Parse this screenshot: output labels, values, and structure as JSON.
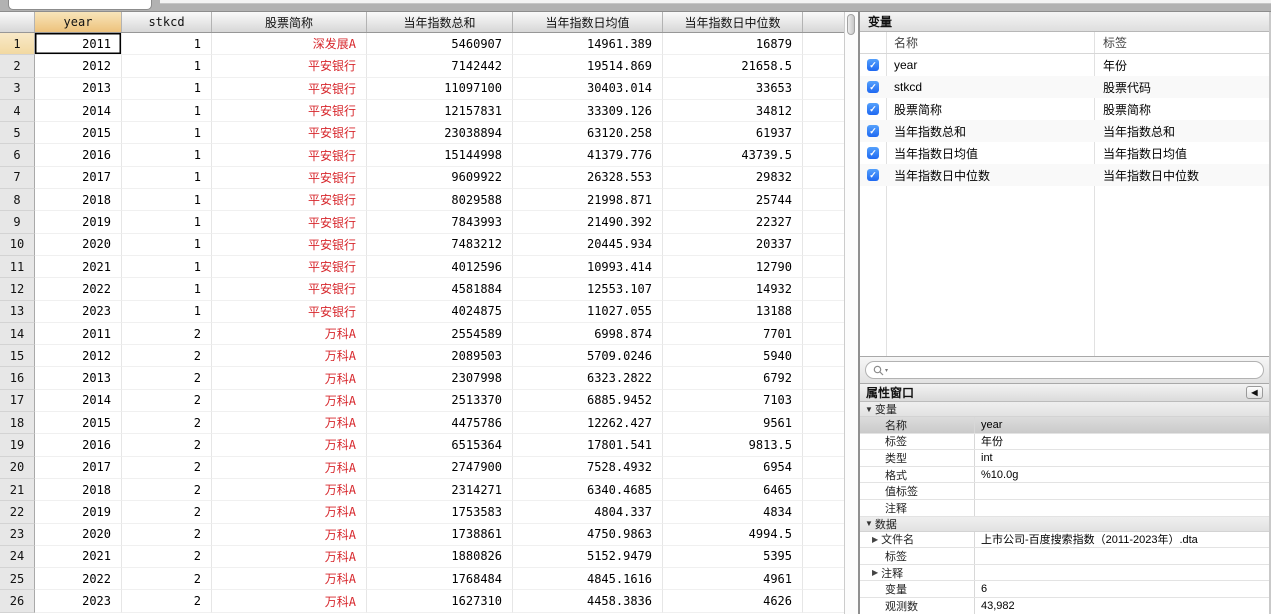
{
  "table": {
    "headers": {
      "year": "year",
      "stkcd": "stkcd",
      "name": "股票简称",
      "sum": "当年指数总和",
      "mean": "当年指数日均值",
      "median": "当年指数日中位数"
    },
    "selected_cell": {
      "row": 1,
      "column": "year",
      "value": "2011"
    },
    "rows": [
      {
        "n": "1",
        "year": "2011",
        "stkcd": "1",
        "name": "深发展A",
        "sum": "5460907",
        "mean": "14961.389",
        "median": "16879"
      },
      {
        "n": "2",
        "year": "2012",
        "stkcd": "1",
        "name": "平安银行",
        "sum": "7142442",
        "mean": "19514.869",
        "median": "21658.5"
      },
      {
        "n": "3",
        "year": "2013",
        "stkcd": "1",
        "name": "平安银行",
        "sum": "11097100",
        "mean": "30403.014",
        "median": "33653"
      },
      {
        "n": "4",
        "year": "2014",
        "stkcd": "1",
        "name": "平安银行",
        "sum": "12157831",
        "mean": "33309.126",
        "median": "34812"
      },
      {
        "n": "5",
        "year": "2015",
        "stkcd": "1",
        "name": "平安银行",
        "sum": "23038894",
        "mean": "63120.258",
        "median": "61937"
      },
      {
        "n": "6",
        "year": "2016",
        "stkcd": "1",
        "name": "平安银行",
        "sum": "15144998",
        "mean": "41379.776",
        "median": "43739.5"
      },
      {
        "n": "7",
        "year": "2017",
        "stkcd": "1",
        "name": "平安银行",
        "sum": "9609922",
        "mean": "26328.553",
        "median": "29832"
      },
      {
        "n": "8",
        "year": "2018",
        "stkcd": "1",
        "name": "平安银行",
        "sum": "8029588",
        "mean": "21998.871",
        "median": "25744"
      },
      {
        "n": "9",
        "year": "2019",
        "stkcd": "1",
        "name": "平安银行",
        "sum": "7843993",
        "mean": "21490.392",
        "median": "22327"
      },
      {
        "n": "10",
        "year": "2020",
        "stkcd": "1",
        "name": "平安银行",
        "sum": "7483212",
        "mean": "20445.934",
        "median": "20337"
      },
      {
        "n": "11",
        "year": "2021",
        "stkcd": "1",
        "name": "平安银行",
        "sum": "4012596",
        "mean": "10993.414",
        "median": "12790"
      },
      {
        "n": "12",
        "year": "2022",
        "stkcd": "1",
        "name": "平安银行",
        "sum": "4581884",
        "mean": "12553.107",
        "median": "14932"
      },
      {
        "n": "13",
        "year": "2023",
        "stkcd": "1",
        "name": "平安银行",
        "sum": "4024875",
        "mean": "11027.055",
        "median": "13188"
      },
      {
        "n": "14",
        "year": "2011",
        "stkcd": "2",
        "name": "万科A",
        "sum": "2554589",
        "mean": "6998.874",
        "median": "7701"
      },
      {
        "n": "15",
        "year": "2012",
        "stkcd": "2",
        "name": "万科A",
        "sum": "2089503",
        "mean": "5709.0246",
        "median": "5940"
      },
      {
        "n": "16",
        "year": "2013",
        "stkcd": "2",
        "name": "万科A",
        "sum": "2307998",
        "mean": "6323.2822",
        "median": "6792"
      },
      {
        "n": "17",
        "year": "2014",
        "stkcd": "2",
        "name": "万科A",
        "sum": "2513370",
        "mean": "6885.9452",
        "median": "7103"
      },
      {
        "n": "18",
        "year": "2015",
        "stkcd": "2",
        "name": "万科A",
        "sum": "4475786",
        "mean": "12262.427",
        "median": "9561"
      },
      {
        "n": "19",
        "year": "2016",
        "stkcd": "2",
        "name": "万科A",
        "sum": "6515364",
        "mean": "17801.541",
        "median": "9813.5"
      },
      {
        "n": "20",
        "year": "2017",
        "stkcd": "2",
        "name": "万科A",
        "sum": "2747900",
        "mean": "7528.4932",
        "median": "6954"
      },
      {
        "n": "21",
        "year": "2018",
        "stkcd": "2",
        "name": "万科A",
        "sum": "2314271",
        "mean": "6340.4685",
        "median": "6465"
      },
      {
        "n": "22",
        "year": "2019",
        "stkcd": "2",
        "name": "万科A",
        "sum": "1753583",
        "mean": "4804.337",
        "median": "4834"
      },
      {
        "n": "23",
        "year": "2020",
        "stkcd": "2",
        "name": "万科A",
        "sum": "1738861",
        "mean": "4750.9863",
        "median": "4994.5"
      },
      {
        "n": "24",
        "year": "2021",
        "stkcd": "2",
        "name": "万科A",
        "sum": "1880826",
        "mean": "5152.9479",
        "median": "5395"
      },
      {
        "n": "25",
        "year": "2022",
        "stkcd": "2",
        "name": "万科A",
        "sum": "1768484",
        "mean": "4845.1616",
        "median": "4961"
      },
      {
        "n": "26",
        "year": "2023",
        "stkcd": "2",
        "name": "万科A",
        "sum": "1627310",
        "mean": "4458.3836",
        "median": "4626"
      }
    ]
  },
  "variables_panel": {
    "title": "变量",
    "columns": {
      "name": "名称",
      "label": "标签"
    },
    "items": [
      {
        "checked": true,
        "name": "year",
        "label": "年份"
      },
      {
        "checked": true,
        "name": "stkcd",
        "label": "股票代码"
      },
      {
        "checked": true,
        "name": "股票简称",
        "label": "股票简称"
      },
      {
        "checked": true,
        "name": "当年指数总和",
        "label": "当年指数总和"
      },
      {
        "checked": true,
        "name": "当年指数日均值",
        "label": "当年指数日均值"
      },
      {
        "checked": true,
        "name": "当年指数日中位数",
        "label": "当年指数日中位数"
      }
    ]
  },
  "search": {
    "value": ""
  },
  "properties_panel": {
    "title": "属性窗口",
    "collapse_button": "◀",
    "sections": [
      {
        "title": "变量",
        "rows": [
          {
            "label": "名称",
            "value": "year",
            "selected": true
          },
          {
            "label": "标签",
            "value": "年份"
          },
          {
            "label": "类型",
            "value": "int"
          },
          {
            "label": "格式",
            "value": "%10.0g"
          },
          {
            "label": "值标签",
            "value": ""
          },
          {
            "label": "注释",
            "value": ""
          }
        ]
      },
      {
        "title": "数据",
        "rows": [
          {
            "label": "文件名",
            "value": "上市公司-百度搜索指数（2011-2023年）.dta",
            "disclosure": true
          },
          {
            "label": "标签",
            "value": ""
          },
          {
            "label": "注释",
            "value": "",
            "disclosure": true
          },
          {
            "label": "变量",
            "value": "6"
          },
          {
            "label": "观测数",
            "value": "43,982"
          }
        ]
      }
    ]
  },
  "colors": {
    "selected_column_header": "#edc27c",
    "string_value_red": "#d7272c",
    "checkbox_blue": "#2e7bf4"
  }
}
